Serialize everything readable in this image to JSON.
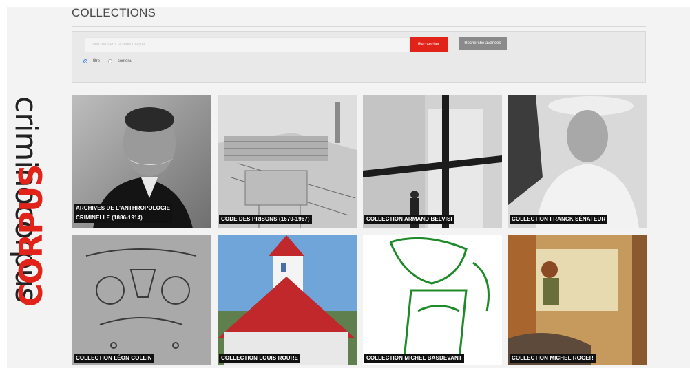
{
  "brand": {
    "top_text": "criminocorpus",
    "bottom_text": "CORPUS"
  },
  "page": {
    "title": "COLLECTIONS"
  },
  "search": {
    "placeholder": "Chercher dans la Bibliothèque",
    "search_label": "Rechercher",
    "advanced_label": "Recherche avancée",
    "options": [
      {
        "label": "titre",
        "selected": true
      },
      {
        "label": "contenu",
        "selected": false
      }
    ]
  },
  "collections": [
    {
      "line1": "ARCHIVES DE L'ANTHROPOLOGIE",
      "line2": "CRIMINELLE (1886-1914)"
    },
    {
      "line1": "CODE DES PRISONS (1670-1967)"
    },
    {
      "line1": "COLLECTION ARMAND BELVISI"
    },
    {
      "line1": "COLLECTION FRANCK SÉNATEUR"
    },
    {
      "line1": "COLLECTION LÉON COLLIN"
    },
    {
      "line1": "COLLECTION LOUIS ROURE"
    },
    {
      "line1": "COLLECTION MICHEL BASDEVANT"
    },
    {
      "line1": "COLLECTION MICHEL ROGER"
    }
  ],
  "colors": {
    "accent": "#e2231a",
    "advanced": "#8a8a8a",
    "radio": "#3b7dd8"
  }
}
